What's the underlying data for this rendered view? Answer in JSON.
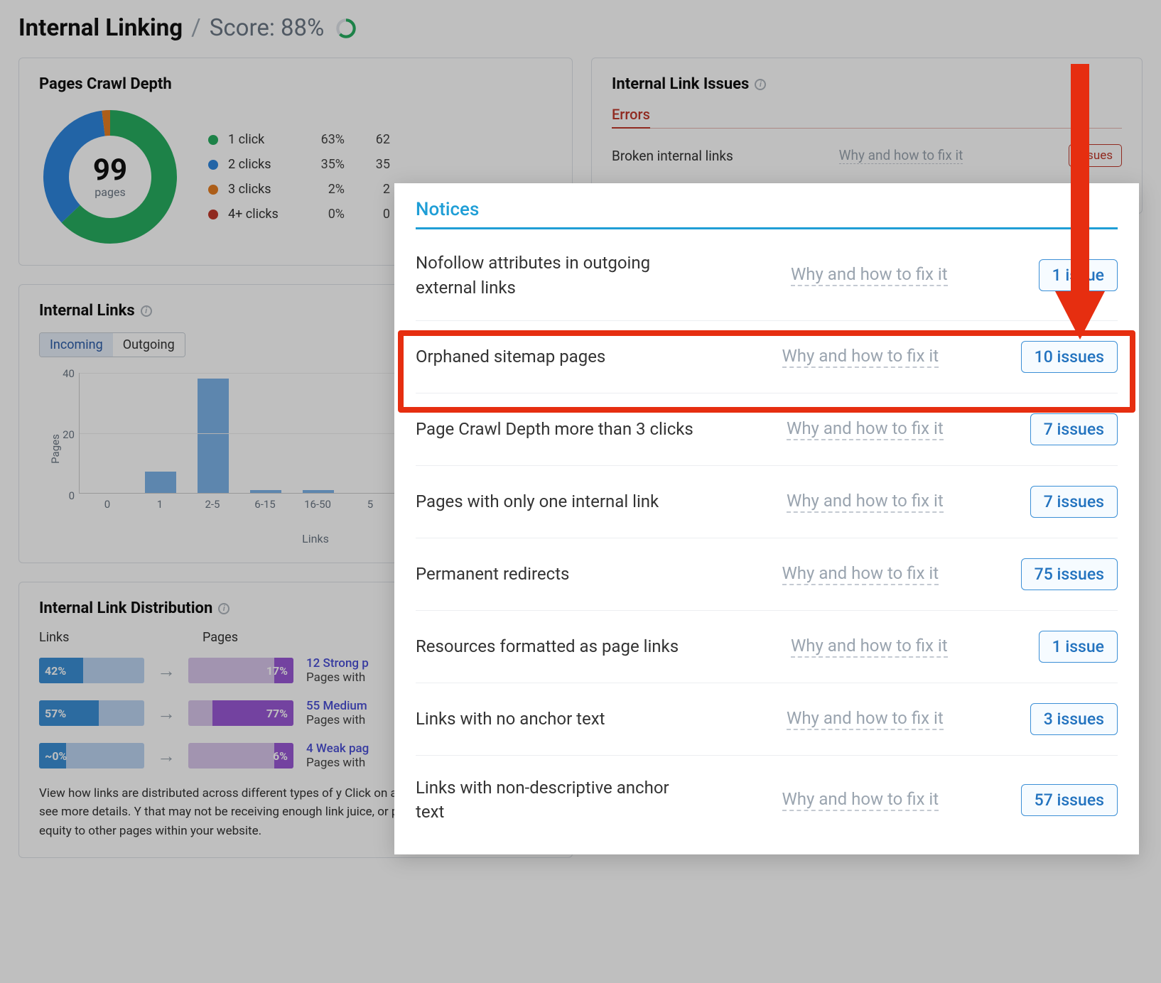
{
  "header": {
    "page_title": "Internal Linking",
    "score_prefix": "Score:",
    "score_value": "88%"
  },
  "crawl_depth": {
    "title": "Pages Crawl Depth",
    "center_value": "99",
    "center_label": "pages",
    "legend": [
      {
        "label": "1 click",
        "pct": "63%",
        "count": "62",
        "color": "#27ae60"
      },
      {
        "label": "2 clicks",
        "pct": "35%",
        "count": "35",
        "color": "#2e86de"
      },
      {
        "label": "3 clicks",
        "pct": "2%",
        "count": "2",
        "color": "#e67e22"
      },
      {
        "label": "4+ clicks",
        "pct": "0%",
        "count": "0",
        "color": "#c0392b"
      }
    ]
  },
  "internal_links_chart": {
    "title": "Internal Links",
    "tabs": {
      "incoming": "Incoming",
      "outgoing": "Outgoing"
    },
    "y_label": "Pages",
    "x_label": "Links",
    "y_ticks": [
      "40",
      "20",
      "0"
    ]
  },
  "chart_data": [
    {
      "type": "pie",
      "title": "Pages Crawl Depth",
      "categories": [
        "1 click",
        "2 clicks",
        "3 clicks",
        "4+ clicks"
      ],
      "values": [
        62,
        35,
        2,
        0
      ],
      "total": 99
    },
    {
      "type": "bar",
      "title": "Internal Links — Incoming",
      "xlabel": "Links",
      "ylabel": "Pages",
      "ylim": [
        0,
        40
      ],
      "categories": [
        "0",
        "1",
        "2-5",
        "6-15",
        "16-50",
        "5"
      ],
      "values": [
        0,
        7,
        38,
        1,
        1,
        0
      ]
    }
  ],
  "distribution": {
    "title": "Internal Link Distribution",
    "col_links": "Links",
    "col_pages": "Pages",
    "rows": [
      {
        "links_pct": "42%",
        "pages_pct": "17%",
        "link_title": "12 Strong p",
        "desc": "Pages with"
      },
      {
        "links_pct": "57%",
        "pages_pct": "77%",
        "link_title": "55 Medium",
        "desc": "Pages with"
      },
      {
        "links_pct": "~0%",
        "pages_pct": "6%",
        "link_title": "4 Weak pag",
        "desc": "Pages with"
      }
    ],
    "note": "View how links are distributed across different types of y Click on any of the provided types to see more details. Y that may not be receiving enough link juice, or pages tha distribute link equity to other pages within your website."
  },
  "issues_card": {
    "title": "Internal Link Issues",
    "tab_errors": "Errors",
    "row_name": "Broken internal links",
    "fix_text": "Why and how to fix it",
    "pill": "issues"
  },
  "notices": {
    "title": "Notices",
    "fix_text": "Why and how to fix it",
    "rows": [
      {
        "name": "Nofollow attributes in outgoing external links",
        "count": "1 issue"
      },
      {
        "name": "Orphaned sitemap pages",
        "count": "10 issues"
      },
      {
        "name": "Page Crawl Depth more than 3 clicks",
        "count": "7 issues"
      },
      {
        "name": "Pages with only one internal link",
        "count": "7 issues"
      },
      {
        "name": "Permanent redirects",
        "count": "75 issues"
      },
      {
        "name": "Resources formatted as page links",
        "count": "1 issue"
      },
      {
        "name": "Links with no anchor text",
        "count": "3 issues"
      },
      {
        "name": "Links with non-descriptive anchor text",
        "count": "57 issues"
      }
    ]
  },
  "colors": {
    "accent_blue": "#1f9ed6",
    "error_red": "#c0392b",
    "annotation_red": "#e62e10"
  }
}
